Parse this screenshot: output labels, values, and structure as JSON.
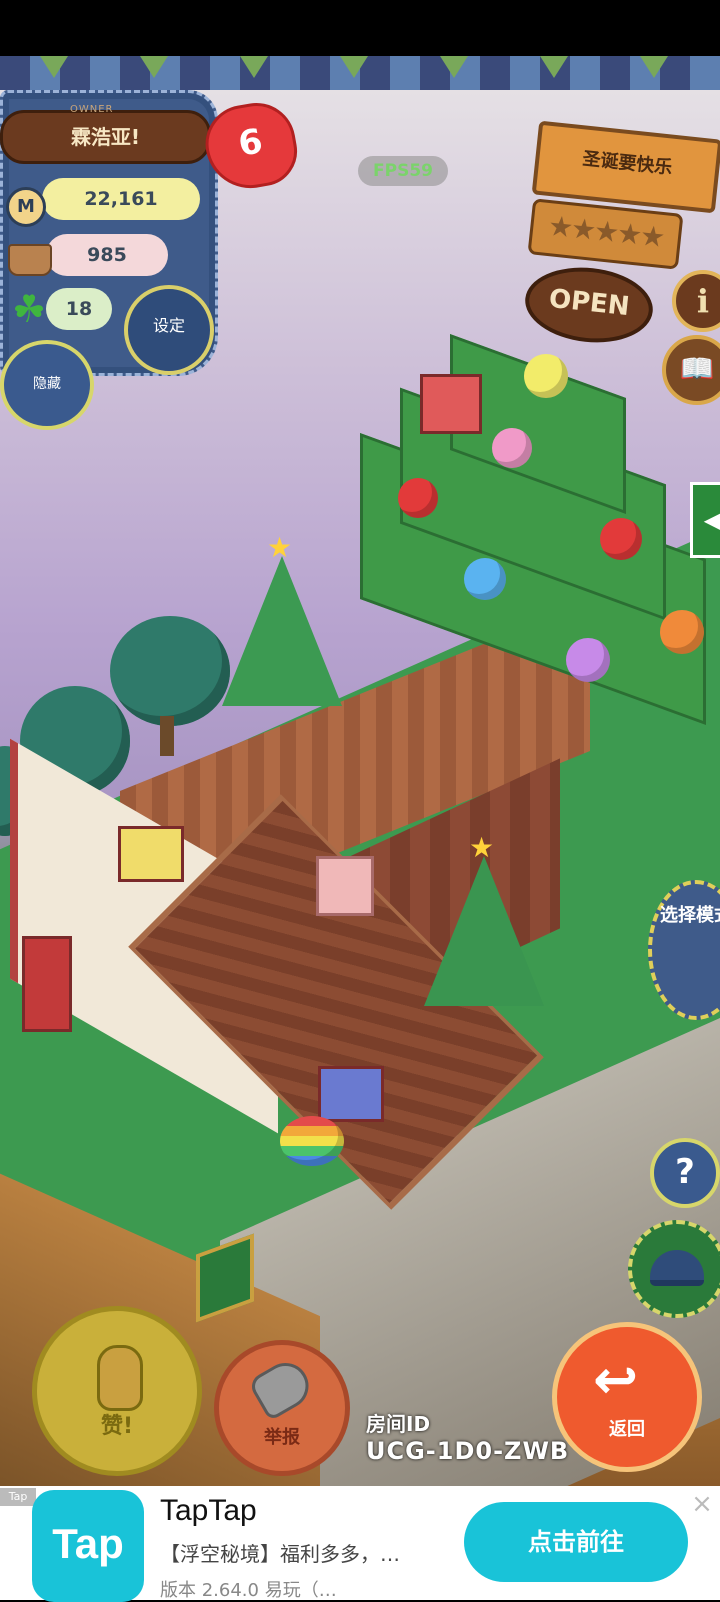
{
  "hud": {
    "owner_label": "OWNER",
    "player_name": "霖浩亚!",
    "hearts": "6",
    "coins": "22,161",
    "produce": "985",
    "clovers": "18",
    "settings_label": "设定",
    "hide_label": "隐藏",
    "fps": "FPS59"
  },
  "shop_sign": {
    "name": "圣诞要快乐",
    "rating_stars": "★★★★★",
    "open_label": "OPEN"
  },
  "right_buttons": {
    "info_glyph": "i",
    "guide_glyph": "📖",
    "mode_label": "选择模式",
    "help_glyph": "?"
  },
  "bottom": {
    "like_label": "赞!",
    "report_label": "举报",
    "room_id_label": "房间ID",
    "room_id": "UCG-1D0-ZWB",
    "back_label": "返回"
  },
  "ad": {
    "tag": "Tap",
    "icon_text": "Tap",
    "title": "TapTap",
    "description": "【浮空秘境】福利多多，…",
    "meta": "版本 2.64.0  易玩（…",
    "cta": "点击前往",
    "close_glyph": "×"
  },
  "colors": {
    "accent_cyan": "#19c3d8",
    "heart_red": "#e5393b",
    "denim_blue": "#3f5b8a",
    "back_orange": "#ef5a2e"
  }
}
